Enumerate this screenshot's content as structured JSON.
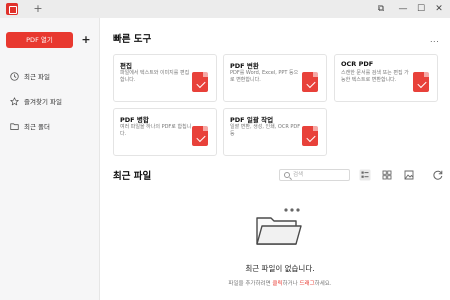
{
  "titlebar": {
    "add_tab_label": "+",
    "controls": {
      "restore": "⧉",
      "minimize": "—",
      "maximize": "☐",
      "close": "✕"
    }
  },
  "sidebar": {
    "open_pdf_label": "PDF 열기",
    "add_label": "+",
    "items": [
      {
        "icon": "clock-icon",
        "label": "최근 파일"
      },
      {
        "icon": "star-icon",
        "label": "즐겨찾기 파일"
      },
      {
        "icon": "folder-icon",
        "label": "최근 폴더"
      }
    ]
  },
  "quick_tools": {
    "title": "빠른 도구",
    "more_label": "...",
    "cards": [
      {
        "title": "편집",
        "desc": "파일에서 텍스트와 이미지를 편집합니다.",
        "icon": "edit-doc-icon",
        "color": "#e8413a"
      },
      {
        "title": "PDF 변환",
        "desc": "PDF를 Word, Excel, PPT 등으로 변환합니다.",
        "icon": "convert-doc-icon",
        "color": "#e8413a"
      },
      {
        "title": "OCR PDF",
        "desc": "스캔한 문서를 검색 또는 편집 가능한 텍스트로 변환합니다.",
        "icon": "ocr-doc-icon",
        "color": "#e8413a"
      },
      {
        "title": "PDF 병합",
        "desc": "여러 파일을 하나의 PDF로 합칩니다.",
        "icon": "merge-doc-icon",
        "color": "#e8413a"
      },
      {
        "title": "PDF 일괄 작업",
        "desc": "일괄 변환, 생성, 인쇄, OCR PDF 등",
        "icon": "batch-doc-icon",
        "color": "#e8413a"
      }
    ]
  },
  "recent": {
    "title": "최근 파일",
    "search_placeholder": "검색",
    "empty_title": "최근 파일이 없습니다.",
    "empty_sub_prefix": "파일을 추가하려면 ",
    "empty_sub_click": "클릭",
    "empty_sub_middle": "하거나 ",
    "empty_sub_drag": "드래그",
    "empty_sub_suffix": "하세요."
  },
  "colors": {
    "accent": "#e8382f",
    "sidebar_bg": "#f6f6f7",
    "titlebar_bg": "#ececec"
  }
}
